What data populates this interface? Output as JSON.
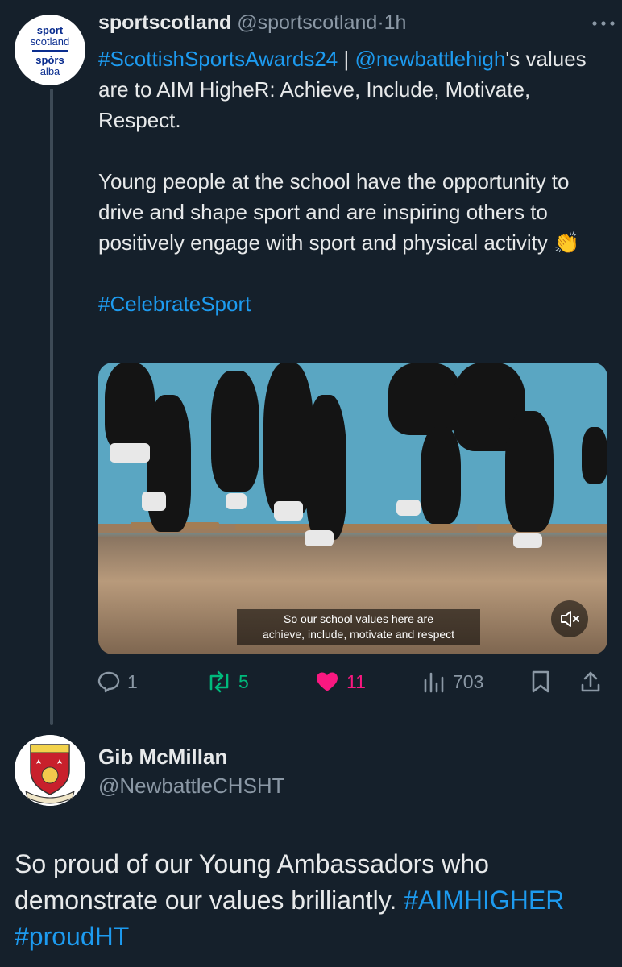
{
  "tweet": {
    "avatar": {
      "lines": [
        "sport",
        "scotland",
        "spòrs",
        "alba"
      ]
    },
    "author_name": "sportscotland",
    "author_handle": "@sportscotland",
    "separator": "·",
    "time": "1h",
    "paragraph1": {
      "hashtag": "#ScottishSportsAwards24",
      "divider": " | ",
      "mention": "@newbattlehigh",
      "rest": "'s values are to AIM HigheR: Achieve, Include, Motivate, Respect."
    },
    "paragraph2": "Young people at the school have the opportunity to drive and shape sport and are inspiring others to positively engage with sport and physical activity",
    "paragraph2_emoji": "👏",
    "paragraph3_hashtag": "#CelebrateSport",
    "video": {
      "caption_line1": "So our school values here are",
      "caption_line2": "achieve, include, motivate and respect"
    },
    "stats": {
      "replies": "1",
      "retweets": "5",
      "likes": "11",
      "views": "703"
    },
    "colors": {
      "accent": "#1d9bf0",
      "retweet": "#00ba7c",
      "like": "#f91880",
      "background": "#15202b"
    }
  },
  "reply": {
    "author_name": "Gib McMillan",
    "author_handle": "@NewbattleCHSHT",
    "text": "So proud of our Young Ambassadors who demonstrate our values brilliantly. ",
    "hashtag1": "#AIMHIGHER",
    "hashtag2": "#proudHT"
  }
}
